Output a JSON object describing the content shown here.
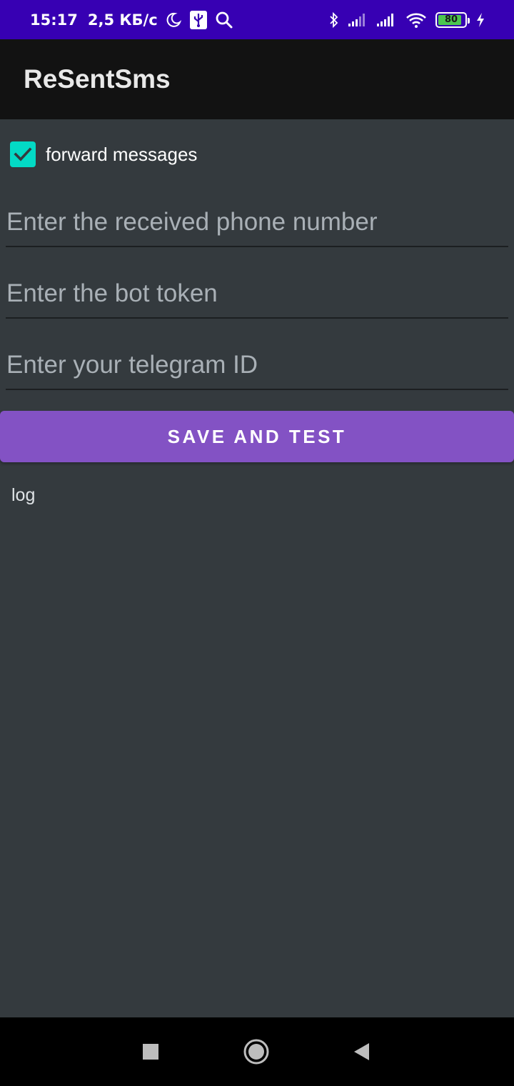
{
  "status_bar": {
    "time": "15:17",
    "speed": "2,5 КБ/с",
    "battery_level": "80",
    "battery_fraction": 0.8,
    "icons": [
      "moon-icon",
      "usb-icon",
      "search-icon",
      "bluetooth-icon",
      "signal-icon",
      "signal-icon",
      "wifi-icon",
      "battery-icon",
      "charging-icon"
    ]
  },
  "app_bar": {
    "title": "ReSentSms"
  },
  "form": {
    "forward_checkbox": {
      "label": "forward messages",
      "checked": true
    },
    "phone_field": {
      "placeholder": "Enter the received phone number",
      "value": ""
    },
    "token_field": {
      "placeholder": "Enter the bot token",
      "value": ""
    },
    "telegram_id_field": {
      "placeholder": "Enter your telegram ID",
      "value": ""
    },
    "save_button_label": "SAVE AND TEST",
    "log": "log"
  },
  "nav_bar": {
    "buttons": [
      "recent-apps",
      "home",
      "back"
    ]
  },
  "colors": {
    "status_bar_bg": "#3700b3",
    "app_bar_bg": "#121212",
    "content_bg": "#343a3e",
    "accent_teal": "#03dac5",
    "button_purple": "#8352c4"
  }
}
